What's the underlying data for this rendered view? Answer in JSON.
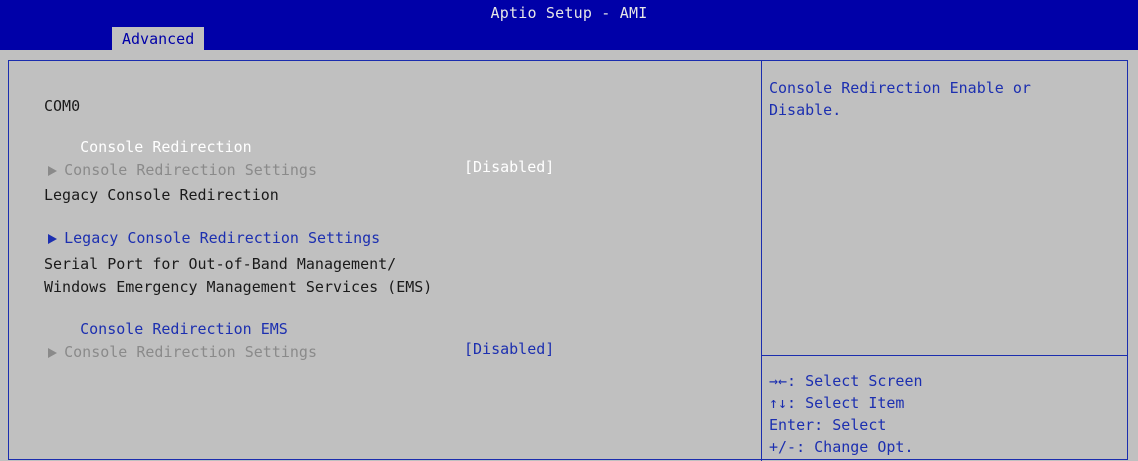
{
  "header": {
    "title": "Aptio Setup - AMI",
    "tab": "Advanced"
  },
  "menu": {
    "com_label": "COM0",
    "console_redirection": {
      "label": "Console Redirection",
      "value": "[Disabled]"
    },
    "console_redirection_settings_1": "Console Redirection Settings",
    "legacy_heading": "Legacy Console Redirection",
    "legacy_settings": "Legacy Console Redirection Settings",
    "serial_heading_line1": "Serial Port for Out-of-Band Management/",
    "serial_heading_line2": "Windows Emergency Management Services (EMS)",
    "console_redirection_ems": {
      "label": "Console Redirection EMS",
      "value": "[Disabled]"
    },
    "console_redirection_settings_2": "Console Redirection Settings"
  },
  "help": {
    "line1": "Console Redirection Enable or",
    "line2": "Disable."
  },
  "keys": {
    "select_screen": "→←: Select Screen",
    "select_item": "↑↓: Select Item",
    "enter": "Enter: Select",
    "change_opt": "+/-: Change Opt."
  }
}
